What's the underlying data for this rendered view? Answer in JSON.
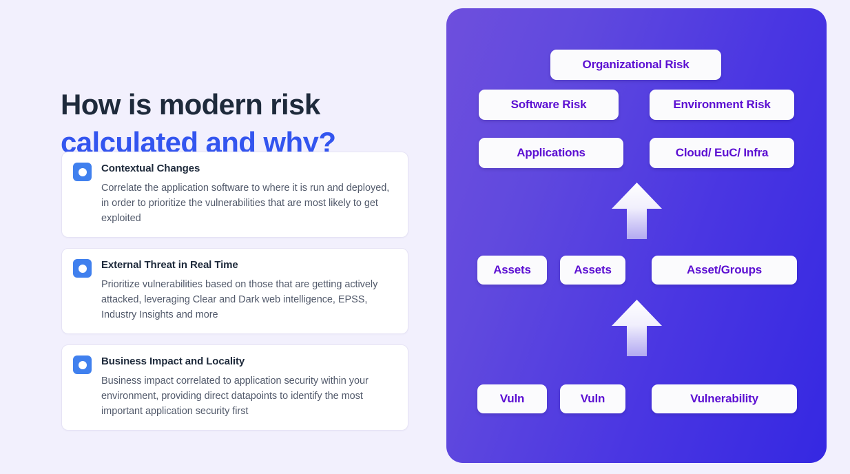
{
  "headline": {
    "line1": "How is modern risk",
    "line2": "calculated and why?"
  },
  "cards": [
    {
      "icon": "filled-circle-badge-icon",
      "title": "Contextual Changes",
      "description": "Correlate the application software to where it is run and deployed, in order to prioritize the vulnerabilities that are most likely to get exploited"
    },
    {
      "icon": "filled-circle-badge-icon",
      "title": "External Threat in Real Time",
      "description": "Prioritize vulnerabilities based on those that are getting actively attacked, leveraging Clear and Dark web intelligence, EPSS, Industry Insights and more"
    },
    {
      "icon": "filled-circle-badge-icon",
      "title": "Business Impact and Locality",
      "description": "Business impact correlated to application security within your environment, providing direct datapoints to identify the most important application security first"
    }
  ],
  "diagram": {
    "chips": {
      "organizational_risk": "Organizational Risk",
      "software_risk": "Software Risk",
      "environment_risk": "Environment Risk",
      "applications": "Applications",
      "cloud_euc_infra": "Cloud/ EuC/ Infra",
      "assets_left": "Assets",
      "assets_mid": "Assets",
      "asset_groups": "Asset/Groups",
      "vuln_left": "Vuln",
      "vuln_mid": "Vuln",
      "vulnerability": "Vulnerability"
    },
    "arrows": {
      "upper": "up-arrow-icon",
      "lower": "up-arrow-icon"
    }
  },
  "colors": {
    "page_background": "#f2f0fd",
    "headline_dark": "#1e2a3b",
    "headline_accent": "#3355ef",
    "card_icon_blue": "#4080ee",
    "chip_text_violet": "#5c0fd2",
    "panel_gradient_start": "#6e4fdd",
    "panel_gradient_end": "#3528e2",
    "body_text": "#525a6b"
  }
}
